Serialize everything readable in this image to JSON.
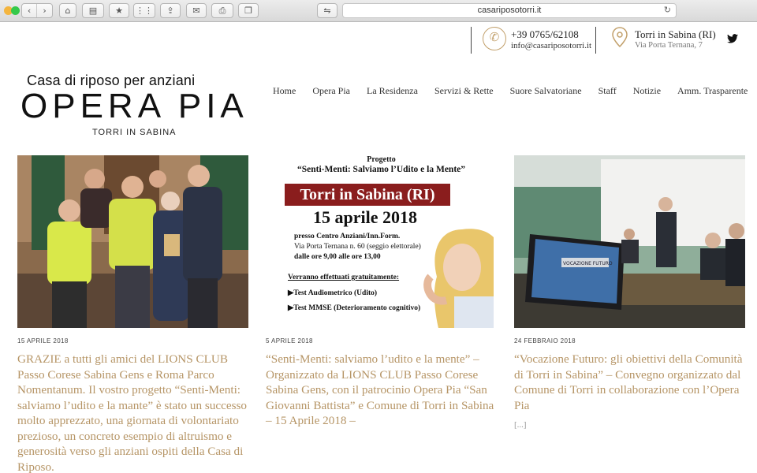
{
  "browser": {
    "url": "casariposotorri.it"
  },
  "contact": {
    "phone": "+39 0765/62108",
    "email": "info@casariposotorri.it",
    "town": "Torri in Sabina (RI)",
    "street": "Via Porta Ternana, 7"
  },
  "logo": {
    "top": "Casa di riposo per anziani",
    "main": "OPERA PIA",
    "sub": "TORRI IN SABINA"
  },
  "nav": [
    "Home",
    "Opera Pia",
    "La Residenza",
    "Servizi & Rette",
    "Suore Salvatoriane",
    "Staff",
    "Notizie",
    "Amm. Trasparente"
  ],
  "posts": [
    {
      "date": "15 APRILE 2018",
      "excerpt": "GRAZIE a tutti gli amici del LIONS CLUB Passo Corese Sabina Gens e Roma Parco Nomentanum. Il vostro progetto “Senti-Menti: salviamo l’udito e la mante” è stato un successo molto apprezzato, una giornata di volontariato prezioso, un concreto esempio di altruismo e generosità verso gli anziani ospiti della Casa di Riposo."
    },
    {
      "date": "5 APRILE 2018",
      "excerpt": "“Senti-Menti: salviamo l’udito e la mente” – Organizzato da LIONS CLUB Passo Corese Sabina Gens, con il patrocinio Opera Pia “San Giovanni Battista” e Comune di Torri in Sabina – 15 Aprile 2018 –"
    },
    {
      "date": "24 FEBBRAIO 2018",
      "excerpt": "“Vocazione Futuro: gli obiettivi della Comunità di Torri in Sabina” – Convegno organizzato dal Comune di Torri in collaborazione con l’Opera Pia",
      "more": "[...]"
    }
  ],
  "poster": {
    "progetto": "Progetto",
    "title": "“Senti-Menti: Salviamo l’Udito e la Mente”",
    "band": "Torri in Sabina (RI)",
    "date": "15 aprile 2018",
    "line1": "presso Centro Anziani/Inn.Form.",
    "line2": "Via Porta Ternana n. 60 (seggio elettorale)",
    "line3": "dalle ore 9,00 alle ore 13,00",
    "line4": "Verranno effettuati gratuitamente:",
    "line5": "▶Test Audiometrico (Udito)",
    "line6": "▶Test MMSE (Deterioramento cognitivo)"
  },
  "screen_text": {
    "vocazione": "VOCAZIONE FUTURO"
  },
  "colors": {
    "accent": "#b69566",
    "poster_band": "#8a1d1d"
  }
}
